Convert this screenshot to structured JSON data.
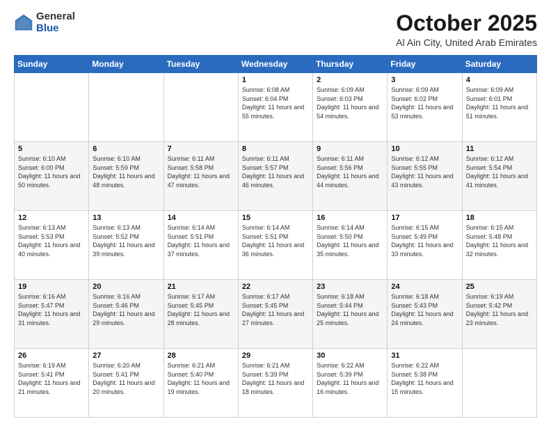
{
  "logo": {
    "general": "General",
    "blue": "Blue"
  },
  "title": {
    "month": "October 2025",
    "location": "Al Ain City, United Arab Emirates"
  },
  "days_of_week": [
    "Sunday",
    "Monday",
    "Tuesday",
    "Wednesday",
    "Thursday",
    "Friday",
    "Saturday"
  ],
  "weeks": [
    [
      {
        "num": "",
        "sunrise": "",
        "sunset": "",
        "daylight": ""
      },
      {
        "num": "",
        "sunrise": "",
        "sunset": "",
        "daylight": ""
      },
      {
        "num": "",
        "sunrise": "",
        "sunset": "",
        "daylight": ""
      },
      {
        "num": "1",
        "sunrise": "Sunrise: 6:08 AM",
        "sunset": "Sunset: 6:04 PM",
        "daylight": "Daylight: 11 hours and 55 minutes."
      },
      {
        "num": "2",
        "sunrise": "Sunrise: 6:09 AM",
        "sunset": "Sunset: 6:03 PM",
        "daylight": "Daylight: 11 hours and 54 minutes."
      },
      {
        "num": "3",
        "sunrise": "Sunrise: 6:09 AM",
        "sunset": "Sunset: 6:02 PM",
        "daylight": "Daylight: 11 hours and 53 minutes."
      },
      {
        "num": "4",
        "sunrise": "Sunrise: 6:09 AM",
        "sunset": "Sunset: 6:01 PM",
        "daylight": "Daylight: 11 hours and 51 minutes."
      }
    ],
    [
      {
        "num": "5",
        "sunrise": "Sunrise: 6:10 AM",
        "sunset": "Sunset: 6:00 PM",
        "daylight": "Daylight: 11 hours and 50 minutes."
      },
      {
        "num": "6",
        "sunrise": "Sunrise: 6:10 AM",
        "sunset": "Sunset: 5:59 PM",
        "daylight": "Daylight: 11 hours and 48 minutes."
      },
      {
        "num": "7",
        "sunrise": "Sunrise: 6:11 AM",
        "sunset": "Sunset: 5:58 PM",
        "daylight": "Daylight: 11 hours and 47 minutes."
      },
      {
        "num": "8",
        "sunrise": "Sunrise: 6:11 AM",
        "sunset": "Sunset: 5:57 PM",
        "daylight": "Daylight: 11 hours and 46 minutes."
      },
      {
        "num": "9",
        "sunrise": "Sunrise: 6:11 AM",
        "sunset": "Sunset: 5:56 PM",
        "daylight": "Daylight: 11 hours and 44 minutes."
      },
      {
        "num": "10",
        "sunrise": "Sunrise: 6:12 AM",
        "sunset": "Sunset: 5:55 PM",
        "daylight": "Daylight: 11 hours and 43 minutes."
      },
      {
        "num": "11",
        "sunrise": "Sunrise: 6:12 AM",
        "sunset": "Sunset: 5:54 PM",
        "daylight": "Daylight: 11 hours and 41 minutes."
      }
    ],
    [
      {
        "num": "12",
        "sunrise": "Sunrise: 6:13 AM",
        "sunset": "Sunset: 5:53 PM",
        "daylight": "Daylight: 11 hours and 40 minutes."
      },
      {
        "num": "13",
        "sunrise": "Sunrise: 6:13 AM",
        "sunset": "Sunset: 5:52 PM",
        "daylight": "Daylight: 11 hours and 39 minutes."
      },
      {
        "num": "14",
        "sunrise": "Sunrise: 6:14 AM",
        "sunset": "Sunset: 5:51 PM",
        "daylight": "Daylight: 11 hours and 37 minutes."
      },
      {
        "num": "15",
        "sunrise": "Sunrise: 6:14 AM",
        "sunset": "Sunset: 5:51 PM",
        "daylight": "Daylight: 11 hours and 36 minutes."
      },
      {
        "num": "16",
        "sunrise": "Sunrise: 6:14 AM",
        "sunset": "Sunset: 5:50 PM",
        "daylight": "Daylight: 11 hours and 35 minutes."
      },
      {
        "num": "17",
        "sunrise": "Sunrise: 6:15 AM",
        "sunset": "Sunset: 5:49 PM",
        "daylight": "Daylight: 11 hours and 33 minutes."
      },
      {
        "num": "18",
        "sunrise": "Sunrise: 6:15 AM",
        "sunset": "Sunset: 5:48 PM",
        "daylight": "Daylight: 11 hours and 32 minutes."
      }
    ],
    [
      {
        "num": "19",
        "sunrise": "Sunrise: 6:16 AM",
        "sunset": "Sunset: 5:47 PM",
        "daylight": "Daylight: 11 hours and 31 minutes."
      },
      {
        "num": "20",
        "sunrise": "Sunrise: 6:16 AM",
        "sunset": "Sunset: 5:46 PM",
        "daylight": "Daylight: 11 hours and 29 minutes."
      },
      {
        "num": "21",
        "sunrise": "Sunrise: 6:17 AM",
        "sunset": "Sunset: 5:45 PM",
        "daylight": "Daylight: 11 hours and 28 minutes."
      },
      {
        "num": "22",
        "sunrise": "Sunrise: 6:17 AM",
        "sunset": "Sunset: 5:45 PM",
        "daylight": "Daylight: 11 hours and 27 minutes."
      },
      {
        "num": "23",
        "sunrise": "Sunrise: 6:18 AM",
        "sunset": "Sunset: 5:44 PM",
        "daylight": "Daylight: 11 hours and 25 minutes."
      },
      {
        "num": "24",
        "sunrise": "Sunrise: 6:18 AM",
        "sunset": "Sunset: 5:43 PM",
        "daylight": "Daylight: 11 hours and 24 minutes."
      },
      {
        "num": "25",
        "sunrise": "Sunrise: 6:19 AM",
        "sunset": "Sunset: 5:42 PM",
        "daylight": "Daylight: 11 hours and 23 minutes."
      }
    ],
    [
      {
        "num": "26",
        "sunrise": "Sunrise: 6:19 AM",
        "sunset": "Sunset: 5:41 PM",
        "daylight": "Daylight: 11 hours and 21 minutes."
      },
      {
        "num": "27",
        "sunrise": "Sunrise: 6:20 AM",
        "sunset": "Sunset: 5:41 PM",
        "daylight": "Daylight: 11 hours and 20 minutes."
      },
      {
        "num": "28",
        "sunrise": "Sunrise: 6:21 AM",
        "sunset": "Sunset: 5:40 PM",
        "daylight": "Daylight: 11 hours and 19 minutes."
      },
      {
        "num": "29",
        "sunrise": "Sunrise: 6:21 AM",
        "sunset": "Sunset: 5:39 PM",
        "daylight": "Daylight: 11 hours and 18 minutes."
      },
      {
        "num": "30",
        "sunrise": "Sunrise: 6:22 AM",
        "sunset": "Sunset: 5:39 PM",
        "daylight": "Daylight: 11 hours and 16 minutes."
      },
      {
        "num": "31",
        "sunrise": "Sunrise: 6:22 AM",
        "sunset": "Sunset: 5:38 PM",
        "daylight": "Daylight: 11 hours and 15 minutes."
      },
      {
        "num": "",
        "sunrise": "",
        "sunset": "",
        "daylight": ""
      }
    ]
  ]
}
